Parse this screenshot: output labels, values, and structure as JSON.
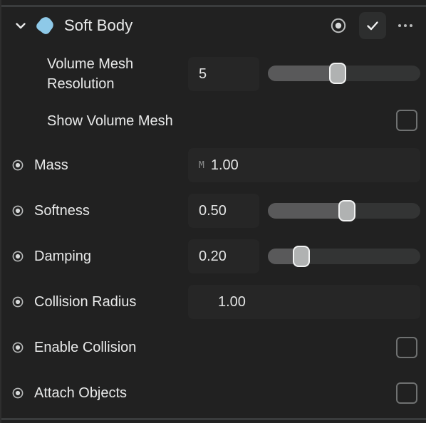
{
  "panel": {
    "background": "#212121",
    "accent": "#8ec9e8"
  },
  "header": {
    "title": "Soft Body",
    "expanded": true,
    "chevron_icon": "chevron-down-icon",
    "object_icon": "soft-body-blob-icon",
    "record_icon": "record-keyframe-icon",
    "check_icon": "checkmark-icon",
    "menu_icon": "more-options-icon"
  },
  "properties": [
    {
      "id": "volume-mesh-resolution",
      "label": "Volume Mesh\nResolution",
      "has_keyframe_dot": false,
      "control": "slider",
      "value": "5",
      "unit": "",
      "slider_percent": 46
    },
    {
      "id": "show-volume-mesh",
      "label": "Show Volume Mesh",
      "has_keyframe_dot": false,
      "control": "checkbox",
      "checked": false
    },
    {
      "id": "mass",
      "label": "Mass",
      "has_keyframe_dot": true,
      "control": "field-wide",
      "value": "1.00",
      "unit": "M"
    },
    {
      "id": "softness",
      "label": "Softness",
      "has_keyframe_dot": true,
      "control": "slider",
      "value": "0.50",
      "unit": "",
      "slider_percent": 52
    },
    {
      "id": "damping",
      "label": "Damping",
      "has_keyframe_dot": true,
      "control": "slider",
      "value": "0.20",
      "unit": "",
      "slider_percent": 22
    },
    {
      "id": "collision-radius",
      "label": "Collision Radius",
      "has_keyframe_dot": true,
      "control": "field-wide-centered",
      "value": "1.00",
      "unit": ""
    },
    {
      "id": "enable-collision",
      "label": "Enable Collision",
      "has_keyframe_dot": true,
      "control": "checkbox",
      "checked": false
    },
    {
      "id": "attach-objects",
      "label": "Attach Objects",
      "has_keyframe_dot": true,
      "control": "checkbox",
      "checked": false
    }
  ]
}
